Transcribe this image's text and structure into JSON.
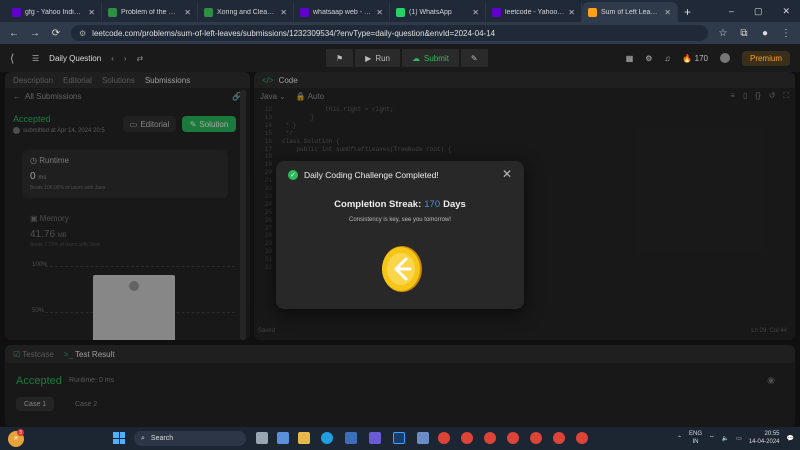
{
  "browser": {
    "tabs": [
      {
        "label": "gfg - Yahoo India Search",
        "color": "#6001d2"
      },
      {
        "label": "Problem of the Day | GeeksforGeeks",
        "color": "#2f8d46"
      },
      {
        "label": "Xoring and Clearing | Practice",
        "color": "#2f8d46"
      },
      {
        "label": "whatsaap web - Yahoo India",
        "color": "#6001d2"
      },
      {
        "label": "(1) WhatsApp",
        "color": "#25d366"
      },
      {
        "label": "leetcode - Yahoo India Search",
        "color": "#6001d2"
      },
      {
        "label": "Sum of Left Leaves",
        "color": "#ffa116"
      }
    ],
    "active_tab": 6,
    "url": "leetcode.com/problems/sum-of-left-leaves/submissions/1232309534/?envType=daily-question&envId=2024-04-14"
  },
  "lc_header": {
    "title": "Daily Question",
    "run_label": "Run",
    "submit_label": "Submit",
    "streak": "170",
    "premium": "Premium"
  },
  "left_panel": {
    "tabs": [
      "Description",
      "Editorial",
      "Solutions",
      "Submissions"
    ],
    "all_submissions": "All Submissions",
    "status": "Accepted",
    "submitted_at": "submitted at Apr 14, 2024 20:5",
    "editorial_btn": "Editorial",
    "solution_btn": "Solution",
    "runtime": {
      "label": "Runtime",
      "value": "0",
      "unit": "ms",
      "beats": "Beats 100.00% of users with Java"
    },
    "memory": {
      "label": "Memory",
      "value": "41.76",
      "unit": "MB",
      "beats": "Beats 7.73% of users with Java"
    },
    "chart_ticks": [
      "100%",
      "50%"
    ]
  },
  "editor": {
    "title": "Code",
    "language": "Java",
    "mode": "Auto",
    "lines": [
      {
        "n": "12",
        "t": "            this.right = right;"
      },
      {
        "n": "13",
        "t": "        }"
      },
      {
        "n": "14",
        "t": " * }"
      },
      {
        "n": "15",
        "t": " */"
      },
      {
        "n": "16",
        "t": "class Solution {"
      },
      {
        "n": "17",
        "t": "    public int sumOfLeftLeaves(TreeNode root) {"
      },
      {
        "n": "18",
        "t": ""
      },
      {
        "n": "19",
        "t": ""
      },
      {
        "n": "20",
        "t": ""
      },
      {
        "n": "21",
        "t": ""
      },
      {
        "n": "22",
        "t": ""
      },
      {
        "n": "23",
        "t": ""
      },
      {
        "n": "24",
        "t": ""
      },
      {
        "n": "25",
        "t": ""
      },
      {
        "n": "26",
        "t": ""
      },
      {
        "n": "27",
        "t": ""
      },
      {
        "n": "28",
        "t": ""
      },
      {
        "n": "29",
        "t": ""
      },
      {
        "n": "30",
        "t": ""
      },
      {
        "n": "31",
        "t": ""
      },
      {
        "n": "32",
        "t": ""
      }
    ],
    "saved": "Saved",
    "cursor": "Ln 29, Col 44"
  },
  "bottom": {
    "tabs": [
      "Testcase",
      "Test Result"
    ],
    "result": "Accepted",
    "runtime": "Runtime: 0 ms",
    "cases": [
      "Case 1",
      "Case 2"
    ]
  },
  "modal": {
    "title": "Daily Coding Challenge Completed!",
    "streak_label": "Completion Streak:",
    "streak_value": "170",
    "streak_unit": "Days",
    "subtitle": "Consistency is key, see you tomorrow!"
  },
  "taskbar": {
    "weather_badge": "3",
    "search": "Search",
    "lang": "ENG",
    "region": "IN",
    "time": "20:55",
    "date": "14-04-2024"
  }
}
